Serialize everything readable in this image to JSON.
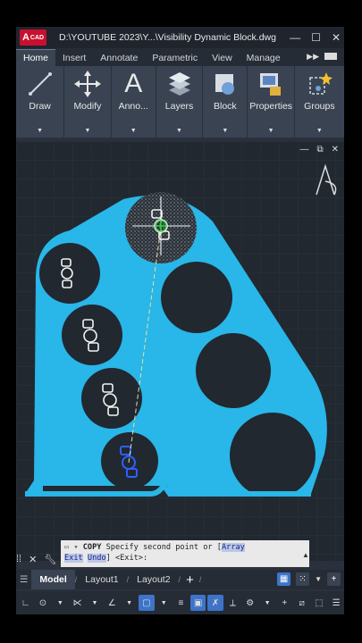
{
  "window": {
    "app_logo_text": "CAD",
    "app_logo_letter": "A",
    "title": "D:\\YOUTUBE 2023\\Y...\\Visibility Dynamic Block.dwg",
    "controls": [
      "—",
      "☐",
      "✕"
    ]
  },
  "ribbon_tabs": [
    "Home",
    "Insert",
    "Annotate",
    "Parametric",
    "View",
    "Manage"
  ],
  "ribbon_tabs_more": "▶▶",
  "ribbon_panels": [
    {
      "label": "Draw",
      "icon": "line-icon"
    },
    {
      "label": "Modify",
      "icon": "move-icon"
    },
    {
      "label": "Anno...",
      "icon": "text-icon"
    },
    {
      "label": "Layers",
      "icon": "layers-icon"
    },
    {
      "label": "Block",
      "icon": "block-icon"
    },
    {
      "label": "Properties",
      "icon": "properties-icon"
    },
    {
      "label": "Groups",
      "icon": "groups-icon"
    }
  ],
  "viewport": {
    "controls": [
      "—",
      "⧉",
      "✕"
    ],
    "colors": {
      "shape": "#29b6e8",
      "background": "#212830",
      "hatch": "#8a8f96",
      "selected": "#2f5fff"
    }
  },
  "command": {
    "prompt_prefix": "COPY",
    "line1": "Specify second point or [",
    "opt1": "Array",
    "line2_opt_exit": "Exit",
    "line2_opt_undo": "Undo",
    "line2_rest": "] <Exit>:"
  },
  "layout_tabs": [
    "Model",
    "Layout1",
    "Layout2"
  ],
  "layout_plus": "+",
  "accent": "#3d74c9"
}
